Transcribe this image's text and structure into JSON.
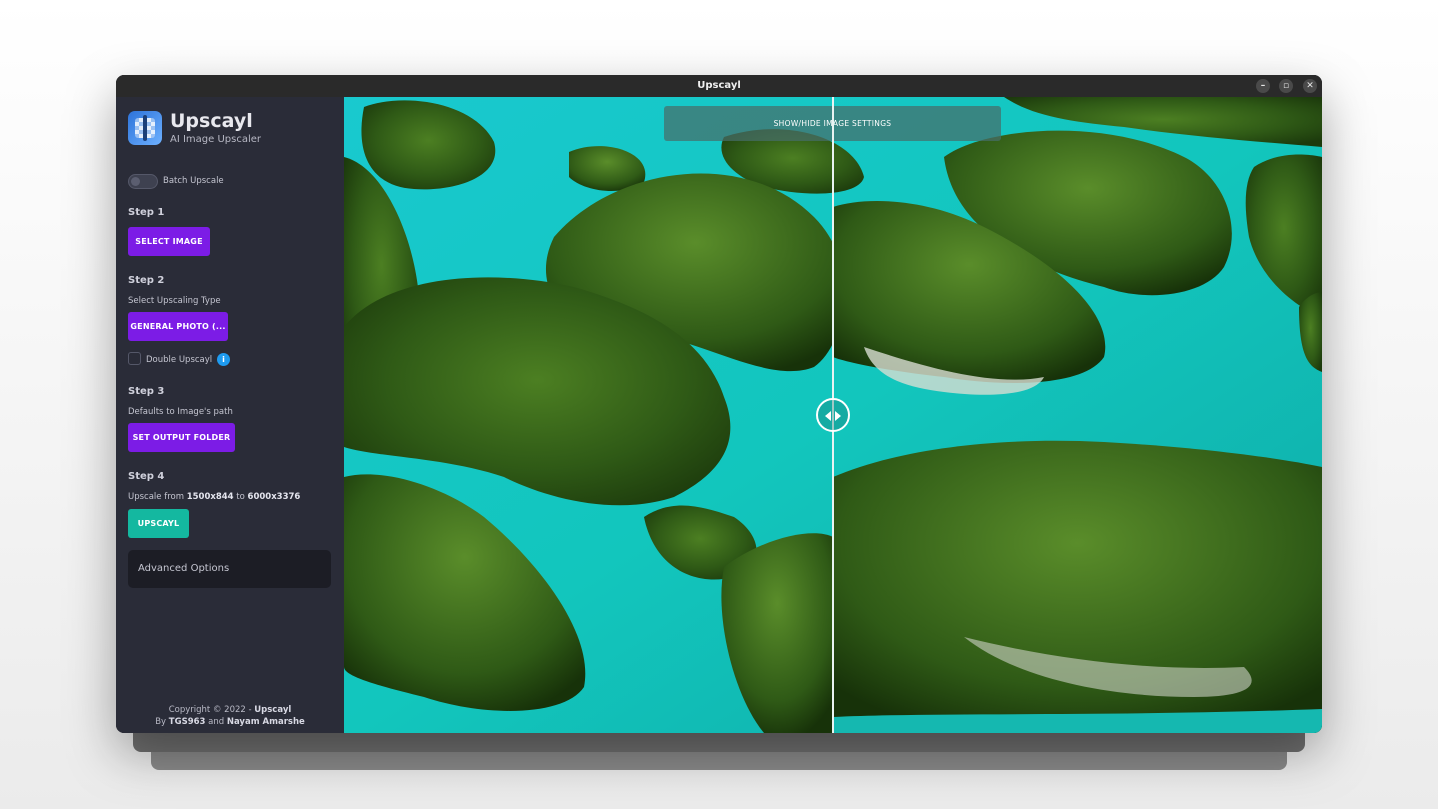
{
  "window": {
    "title": "Upscayl",
    "min": "–",
    "max": "▫",
    "close": "✕"
  },
  "app": {
    "name": "Upscayl",
    "tagline": "AI Image Upscaler"
  },
  "batch": {
    "label": "Batch Upscale",
    "enabled": false
  },
  "step1": {
    "title": "Step 1",
    "button": "SELECT IMAGE"
  },
  "step2": {
    "title": "Step 2",
    "subtitle": "Select Upscaling Type",
    "button": "GENERAL PHOTO (...",
    "double_label": "Double Upscayl",
    "double_checked": false,
    "info": "i"
  },
  "step3": {
    "title": "Step 3",
    "subtitle": "Defaults to Image's path",
    "button": "SET OUTPUT FOLDER"
  },
  "step4": {
    "title": "Step 4",
    "prefix": "Upscale from ",
    "from": "1500x844",
    "mid": " to ",
    "to": "6000x3376",
    "button": "UPSCAYL"
  },
  "advanced": {
    "label": "Advanced Options"
  },
  "footer": {
    "line1_prefix": "Copyright © 2022 - ",
    "line1_brand": "Upscayl",
    "line2_by": "By ",
    "author1": "TGS963",
    "and": " and ",
    "author2": "Nayam Amarshe"
  },
  "viewer": {
    "settings_button": "SHOW/HIDE IMAGE SETTINGS"
  },
  "colors": {
    "accent_purple": "#7c1ce6",
    "accent_teal": "#14b8a0",
    "sidebar_bg": "#2a2c38",
    "water": "#15c9c4",
    "forest": "#2f5a16"
  }
}
